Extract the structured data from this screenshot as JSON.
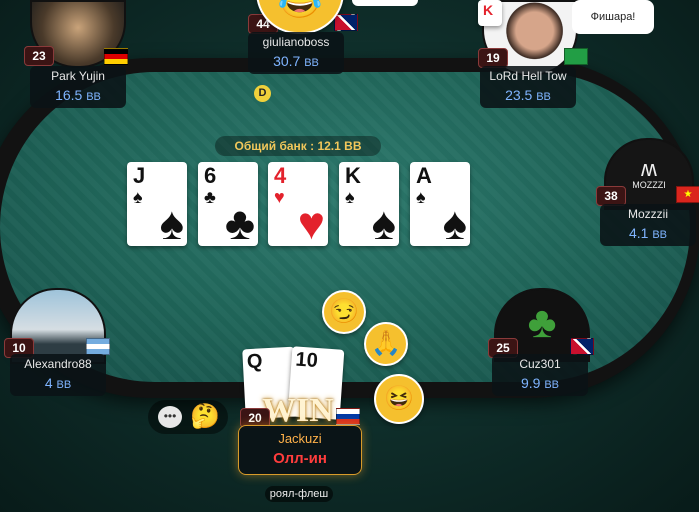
{
  "table": {
    "pot_label": "Общий банк : 12.1 BB",
    "dealer_button": "D",
    "board": [
      {
        "rank": "J",
        "suit": "♠",
        "color": "black"
      },
      {
        "rank": "6",
        "suit": "♣",
        "color": "black"
      },
      {
        "rank": "4",
        "suit": "♥",
        "color": "red"
      },
      {
        "rank": "K",
        "suit": "♠",
        "color": "black"
      },
      {
        "rank": "A",
        "suit": "♠",
        "color": "black"
      }
    ]
  },
  "players": {
    "park": {
      "level": "23",
      "name": "Park Yujin",
      "stack": "16.5",
      "unit": "BB"
    },
    "giuliano": {
      "level": "44",
      "name": "giulianoboss",
      "stack": "30.7",
      "unit": "BB"
    },
    "lord": {
      "level": "19",
      "name": "LoRd Hell Tow",
      "stack": "23.5",
      "unit": "BB",
      "speech": "Фишара!"
    },
    "mozzzii": {
      "level": "38",
      "name": "Mozzzii",
      "stack": "4.1",
      "unit": "BB",
      "avatar_text": "MOZZZI"
    },
    "alex": {
      "level": "10",
      "name": "Alexandro88",
      "stack": "4",
      "unit": "BB"
    },
    "cuz": {
      "level": "25",
      "name": "Cuz301",
      "stack": "9.9",
      "unit": "BB"
    }
  },
  "hero": {
    "level": "20",
    "name": "Jackuzi",
    "status": "Олл-ин",
    "win_text": "WIN",
    "hand_name": "роял-флеш",
    "hole_cards": [
      {
        "rank": "Q"
      },
      {
        "rank": "10"
      }
    ]
  },
  "colors": {
    "pot_text": "#f1c75b",
    "stack_text": "#7fb4ff",
    "hero_name": "#ffb14a",
    "allin": "#ff3d3d"
  }
}
